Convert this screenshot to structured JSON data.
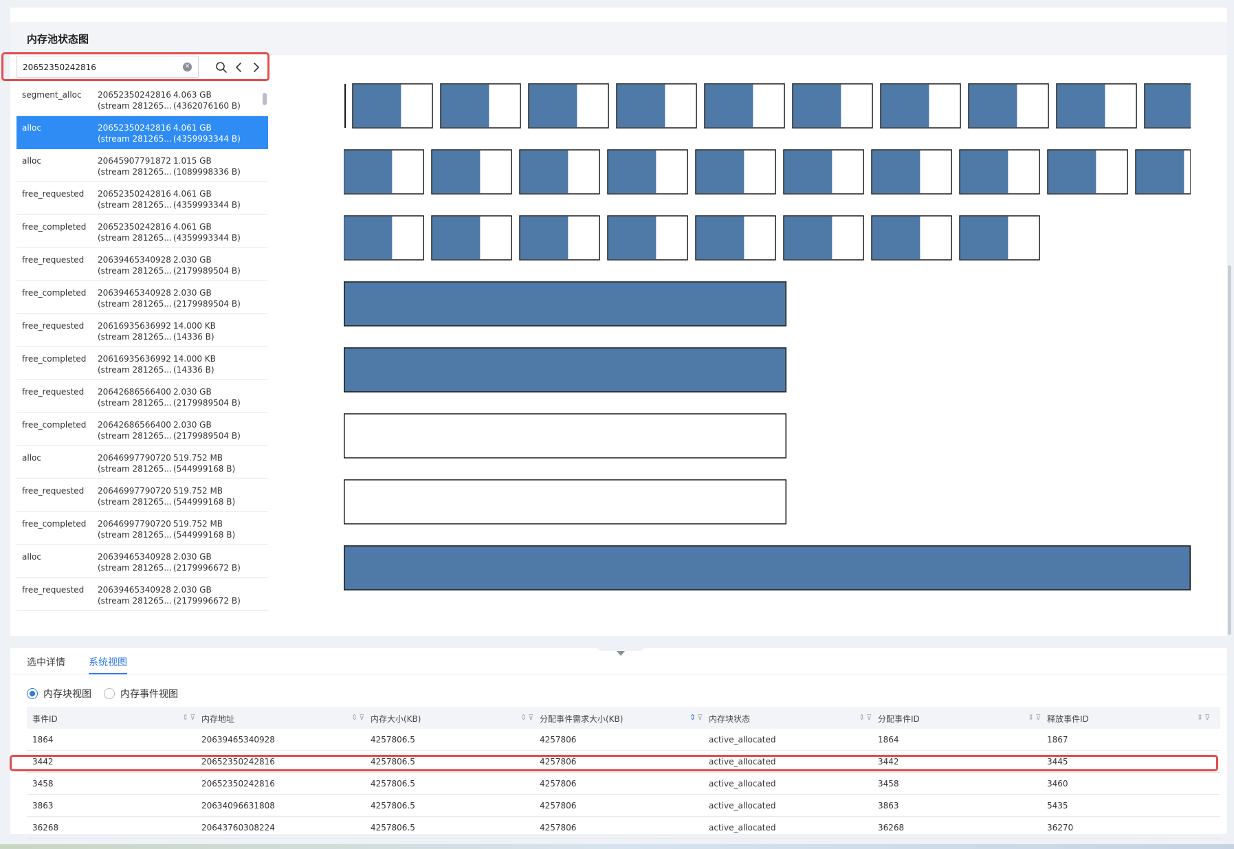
{
  "page": {
    "title": "内存池状态图"
  },
  "search": {
    "value": "20652350242816"
  },
  "event_list": [
    {
      "type": "segment_alloc",
      "address": "20652350242816",
      "stream": "(stream 281265...",
      "size": "4.063 GB",
      "bytes": "(4362076160 B)",
      "selected": false
    },
    {
      "type": "alloc",
      "address": "20652350242816",
      "stream": "(stream 281265...",
      "size": "4.061 GB",
      "bytes": "(4359993344 B)",
      "selected": true
    },
    {
      "type": "alloc",
      "address": "20645907791872",
      "stream": "(stream 281265...",
      "size": "1.015 GB",
      "bytes": "(1089998336 B)",
      "selected": false
    },
    {
      "type": "free_requested",
      "address": "20652350242816",
      "stream": "(stream 281265...",
      "size": "4.061 GB",
      "bytes": "(4359993344 B)",
      "selected": false
    },
    {
      "type": "free_completed",
      "address": "20652350242816",
      "stream": "(stream 281265...",
      "size": "4.061 GB",
      "bytes": "(4359993344 B)",
      "selected": false
    },
    {
      "type": "free_requested",
      "address": "20639465340928",
      "stream": "(stream 281265...",
      "size": "2.030 GB",
      "bytes": "(2179989504 B)",
      "selected": false
    },
    {
      "type": "free_completed",
      "address": "20639465340928",
      "stream": "(stream 281265...",
      "size": "2.030 GB",
      "bytes": "(2179989504 B)",
      "selected": false
    },
    {
      "type": "free_requested",
      "address": "20616935636992",
      "stream": "(stream 281265...",
      "size": "14.000 KB",
      "bytes": "(14336 B)",
      "selected": false
    },
    {
      "type": "free_completed",
      "address": "20616935636992",
      "stream": "(stream 281265...",
      "size": "14.000 KB",
      "bytes": "(14336 B)",
      "selected": false
    },
    {
      "type": "free_requested",
      "address": "20642686566400",
      "stream": "(stream 281265...",
      "size": "2.030 GB",
      "bytes": "(2179989504 B)",
      "selected": false
    },
    {
      "type": "free_completed",
      "address": "20642686566400",
      "stream": "(stream 281265...",
      "size": "2.030 GB",
      "bytes": "(2179989504 B)",
      "selected": false
    },
    {
      "type": "alloc",
      "address": "20646997790720",
      "stream": "(stream 281265...",
      "size": "519.752 MB",
      "bytes": "(544999168 B)",
      "selected": false
    },
    {
      "type": "free_requested",
      "address": "20646997790720",
      "stream": "(stream 281265...",
      "size": "519.752 MB",
      "bytes": "(544999168 B)",
      "selected": false
    },
    {
      "type": "free_completed",
      "address": "20646997790720",
      "stream": "(stream 281265...",
      "size": "519.752 MB",
      "bytes": "(544999168 B)",
      "selected": false
    },
    {
      "type": "alloc",
      "address": "20639465340928",
      "stream": "(stream 281265...",
      "size": "2.030 GB",
      "bytes": "(2179996672 B)",
      "selected": false
    },
    {
      "type": "free_requested",
      "address": "20639465340928",
      "stream": "(stream 281265...",
      "size": "2.030 GB",
      "bytes": "(2179996672 B)",
      "selected": false
    }
  ],
  "memory_blocks": {
    "colors": {
      "allocated": "#4f79a7",
      "free": "#ffffff",
      "border": "#1a1a1a"
    },
    "rows": [
      {
        "kind": "segment",
        "count": 10,
        "fill": 0.6,
        "clipped_last": true,
        "leading_bar": true
      },
      {
        "kind": "segment",
        "count": 10,
        "fill": 0.6,
        "clipped_last": true
      },
      {
        "kind": "segment",
        "count": 8,
        "fill": 0.6
      },
      {
        "kind": "wide",
        "fill": 1
      },
      {
        "kind": "wide",
        "fill": 1
      },
      {
        "kind": "wide",
        "fill": 0
      },
      {
        "kind": "wide",
        "fill": 0
      },
      {
        "kind": "full",
        "fill": 1
      }
    ]
  },
  "tabs": [
    {
      "label": "选中详情",
      "active": false
    },
    {
      "label": "系统视图",
      "active": true
    }
  ],
  "view_mode": {
    "options": [
      {
        "label": "内存块视图",
        "checked": true
      },
      {
        "label": "内存事件视图",
        "checked": false
      }
    ]
  },
  "table": {
    "columns": [
      "事件ID",
      "内存地址",
      "内存大小(KB)",
      "分配事件需求大小(KB)",
      "内存块状态",
      "分配事件ID",
      "释放事件ID"
    ],
    "sorted_column": 3,
    "rows": [
      [
        "1864",
        "20639465340928",
        "4257806.5",
        "4257806",
        "active_allocated",
        "1864",
        "1867"
      ],
      [
        "3442",
        "20652350242816",
        "4257806.5",
        "4257806",
        "active_allocated",
        "3442",
        "3445"
      ],
      [
        "3458",
        "20652350242816",
        "4257806.5",
        "4257806",
        "active_allocated",
        "3458",
        "3460"
      ],
      [
        "3863",
        "20634096631808",
        "4257806.5",
        "4257806",
        "active_allocated",
        "3863",
        "5435"
      ],
      [
        "36268",
        "20643760308224",
        "4257806.5",
        "4257806",
        "active_allocated",
        "36268",
        "36270"
      ]
    ]
  }
}
